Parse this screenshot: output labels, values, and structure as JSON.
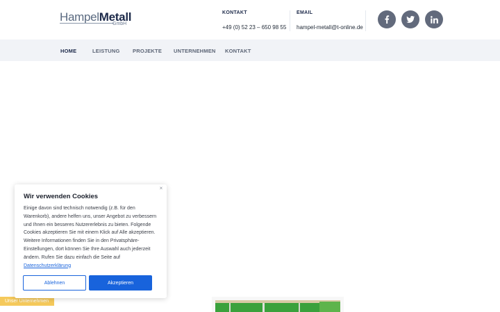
{
  "logo": {
    "word1": "Hampel",
    "word2": "Metall",
    "sub": "GmbH"
  },
  "contact": {
    "phone_label": "KONTAKT",
    "phone": "+49 (0) 52 23 – 650 98 55",
    "email_label": "EMAIL",
    "email": "hampel-metall@t-online.de"
  },
  "social": [
    {
      "icon": "facebook-icon",
      "glyph": "f"
    },
    {
      "icon": "twitter-icon",
      "glyph": "t"
    },
    {
      "icon": "linkedin-icon",
      "glyph": "in"
    }
  ],
  "nav": {
    "items": [
      {
        "label": "HOME",
        "active": true
      },
      {
        "label": "LEISTUNG"
      },
      {
        "label": "PROJEKTE"
      },
      {
        "label": "UNTERNEHMEN"
      },
      {
        "label": "KONTAKT"
      }
    ]
  },
  "cookie": {
    "title": "Wir verwenden Cookies",
    "body": "Einige davon sind technisch notwendig (z.B. für den Warenkorb), andere helfen uns, unser Angebot zu verbessern und Ihnen ein besseres Nutzererlebnis zu bieten. Folgende Cookies akzeptieren Sie mit einem Klick auf Alle akzeptieren. Weitere Informationen finden Sie in den Privatsphäre-Einstellungen, dort können Sie Ihre Auswahl auch jederzeit ändern. Rufen Sie dazu einfach die Seite auf",
    "link": "Datenschutzerklärung",
    "close": "×",
    "reject": "Ablehnen",
    "accept": "Akzeptieren"
  },
  "ribbon": "Unser Unternehmen",
  "colors": {
    "accent": "#1863dc",
    "brand": "#1d2a4a",
    "social_bg": "#626a7c",
    "ribbon": "#f5c95b",
    "nav_bg": "#f1f3f7"
  }
}
